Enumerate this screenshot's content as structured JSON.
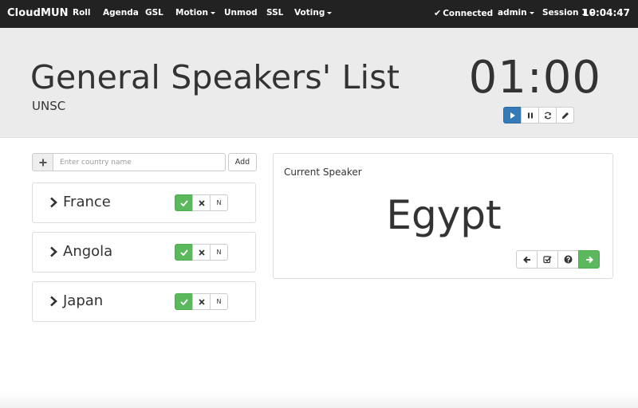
{
  "navbar": {
    "brand": "CloudMUN",
    "items": [
      {
        "label": "Roll",
        "dropdown": false
      },
      {
        "label": "Agenda",
        "dropdown": false
      },
      {
        "label": "GSL",
        "dropdown": false
      },
      {
        "label": "Motion",
        "dropdown": true
      },
      {
        "label": "Unmod",
        "dropdown": false
      },
      {
        "label": "SSL",
        "dropdown": false
      },
      {
        "label": "Voting",
        "dropdown": true
      }
    ],
    "status": "Connected",
    "user": "admin",
    "session": "Session 1",
    "clock": "10:04:47"
  },
  "header": {
    "title": "General Speakers' List",
    "committee": "UNSC",
    "timer": "01:00",
    "controls": [
      "play-icon",
      "pause-icon",
      "refresh-icon",
      "pencil-icon"
    ]
  },
  "add_speaker": {
    "icon": "plus-icon",
    "placeholder": "Enter country name",
    "button": "Add"
  },
  "speakers": [
    {
      "name": "France"
    },
    {
      "name": "Angola"
    },
    {
      "name": "Japan"
    }
  ],
  "vote_buttons": {
    "yes_icon": "check-icon",
    "no_icon": "times-icon",
    "n_label": "N"
  },
  "current": {
    "label": "Current Speaker",
    "name": "Egypt",
    "controls": [
      "arrow-left-icon",
      "check-edit-icon",
      "question-icon",
      "arrow-right-icon"
    ]
  },
  "colors": {
    "navbar_bg": "#222222",
    "header_bg": "#ebebeb",
    "primary": "#337ab7",
    "success": "#5cb85c"
  }
}
